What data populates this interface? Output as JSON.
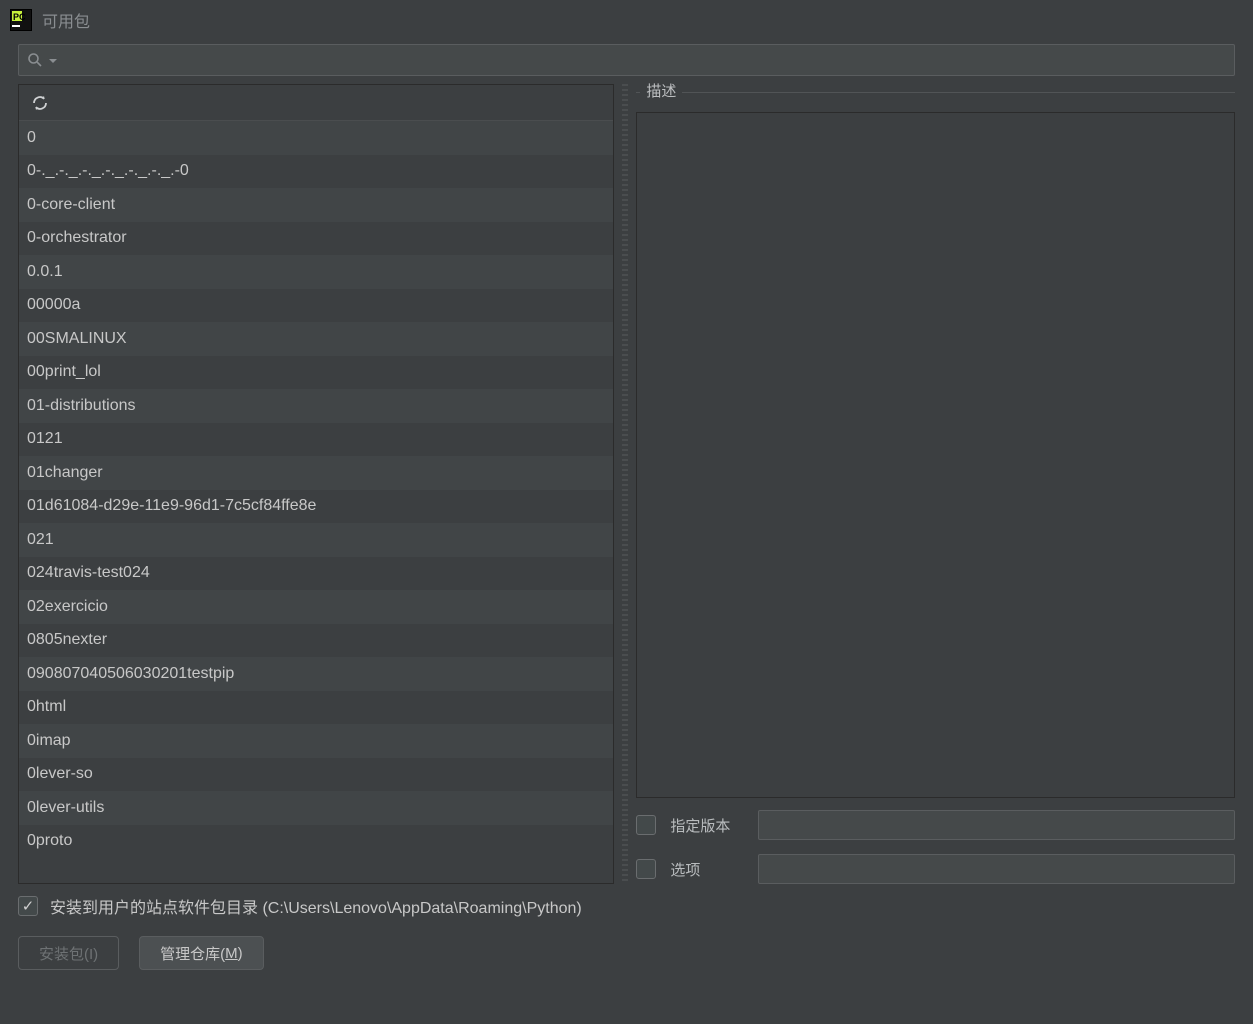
{
  "title": "可用包",
  "search": {
    "value": ""
  },
  "packages": [
    "0",
    "0-._.-._.-._.-._.-._.-._.-0",
    "0-core-client",
    "0-orchestrator",
    "0.0.1",
    "00000a",
    "00SMALINUX",
    "00print_lol",
    "01-distributions",
    "0121",
    "01changer",
    "01d61084-d29e-11e9-96d1-7c5cf84ffe8e",
    "021",
    "024travis-test024",
    "02exercicio",
    "0805nexter",
    "090807040506030201testpip",
    "0html",
    "0imap",
    "0lever-so",
    "0lever-utils",
    "0proto"
  ],
  "description_label": "描述",
  "options": {
    "specify_version_label": "指定版本",
    "specify_version_checked": false,
    "specify_version_value": "",
    "options_label": "选项",
    "options_checked": false,
    "options_value": ""
  },
  "user_site": {
    "checked": true,
    "label": "安装到用户的站点软件包目录 (C:\\Users\\Lenovo\\AppData\\Roaming\\Python)"
  },
  "buttons": {
    "install_label": "安装包(I)",
    "manage_repo_prefix": "管理仓库(",
    "manage_repo_key": "M",
    "manage_repo_suffix": ")"
  }
}
